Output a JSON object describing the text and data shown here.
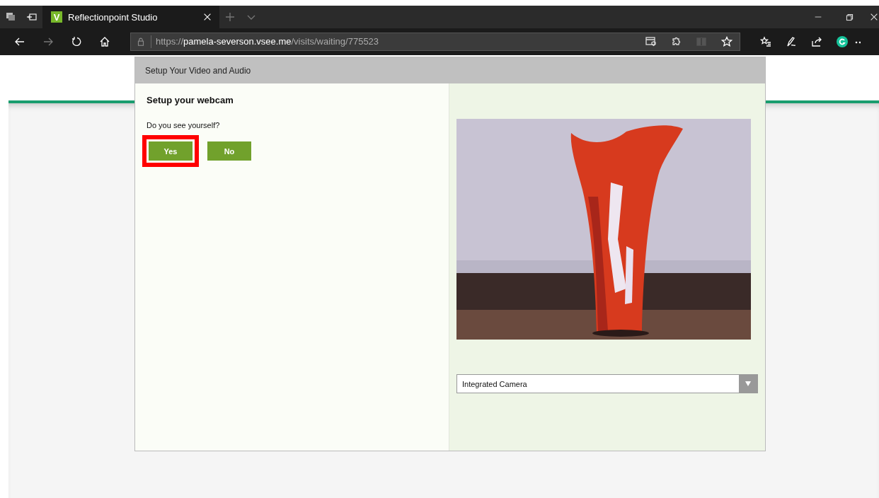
{
  "browser": {
    "tab": {
      "logo": "V",
      "title": "Reflectionpoint Studio",
      "selected": true
    },
    "address": {
      "scheme": "https://",
      "host": "pamela-severson.vsee.me",
      "path": "/visits/waiting/775523"
    }
  },
  "dialog": {
    "title": "Setup Your Video and Audio",
    "heading": "Setup your webcam",
    "question": "Do you see yourself?",
    "buttons": [
      {
        "label": "Yes",
        "highlighted": true
      },
      {
        "label": "No",
        "highlighted": false
      }
    ],
    "camera_select": {
      "value": "Integrated Camera"
    }
  }
}
